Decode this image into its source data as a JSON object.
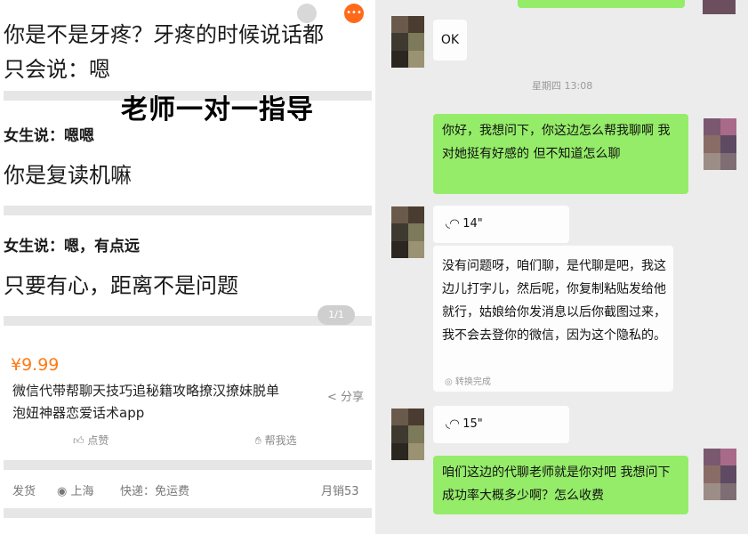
{
  "left": {
    "top_line1": "你是不是牙疼？牙疼的时候说话都",
    "top_line2": "只会说：嗯",
    "banner_title": "老师一对一指导",
    "dialog1_she": "女生说：嗯嗯",
    "dialog1_reply": "你是复读机嘛",
    "dialog2_she": "女生说：嗯，有点远",
    "dialog2_reply": "只要有心，距离不是问题",
    "image_counter": "1/1",
    "product": {
      "price": "¥9.99",
      "title_line1": "微信代带帮聊天技巧追秘籍攻略撩汉撩妹脱单",
      "title_line2": "泡妞神器恋爱话术app",
      "share_label": "分享",
      "like_label": "点赞",
      "help_label": "帮我选",
      "ship_label": "发货",
      "location": "上海",
      "delivery": "快递：免运费",
      "sales": "月销53"
    },
    "icons": {
      "location": "pin-icon",
      "share": "share-icon",
      "like": "thumbs-up-icon",
      "help": "handshake-icon"
    },
    "accent_price": "#ff7a14"
  },
  "right": {
    "msg_ok": "OK",
    "timestamp": "星期四 13:08",
    "msg_user1": "你好，我想问下，你这边怎么帮我聊啊 我对她挺有好感的 但不知道怎么聊",
    "voice1": "14\"",
    "msg_reply_long": "没有问题呀，咱们聊，是代聊是吧，我这边儿打字儿，然后呢，你复制粘贴发给他就行，姑娘给你发消息以后你截图过来，我不会去登你的微信，因为这个隐私的。",
    "transcribe_done": "转换完成",
    "voice2": "15\"",
    "msg_user2": "咱们这边的代聊老师就是你对吧 我想问下成功率大概多少啊？怎么收费",
    "bubble_green": "#95ec69"
  }
}
